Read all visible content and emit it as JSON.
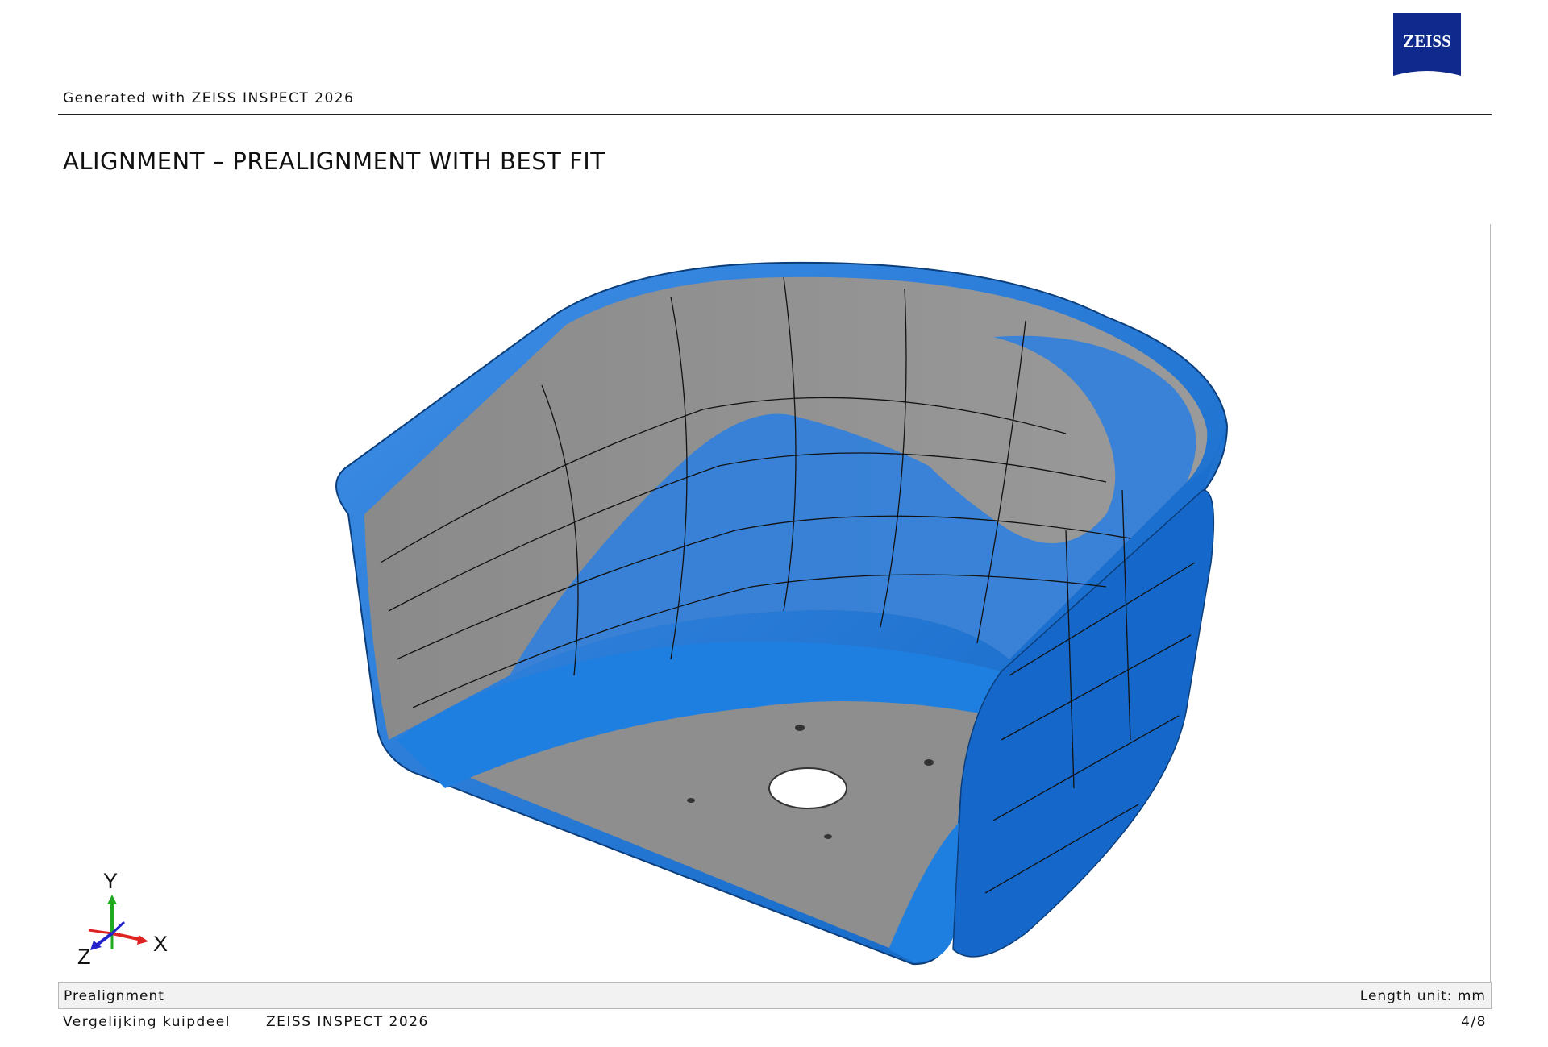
{
  "header": {
    "generated_text": "Generated with ZEISS INSPECT 2026",
    "logo_text": "ZEISS"
  },
  "title": "ALIGNMENT – PREALIGNMENT WITH BEST FIT",
  "viewport": {
    "axes": {
      "x_label": "X",
      "y_label": "Y",
      "z_label": "Z"
    },
    "colors": {
      "surface_gray": "#8c8c8c",
      "deviation_blue": "#1f7fe0",
      "mesh_line": "#111111"
    }
  },
  "caption": {
    "left": "Prealignment",
    "right": "Length unit: mm"
  },
  "footer": {
    "project": "Vergelijking kuipdeel",
    "software": "ZEISS INSPECT 2026",
    "page": "4/8"
  }
}
